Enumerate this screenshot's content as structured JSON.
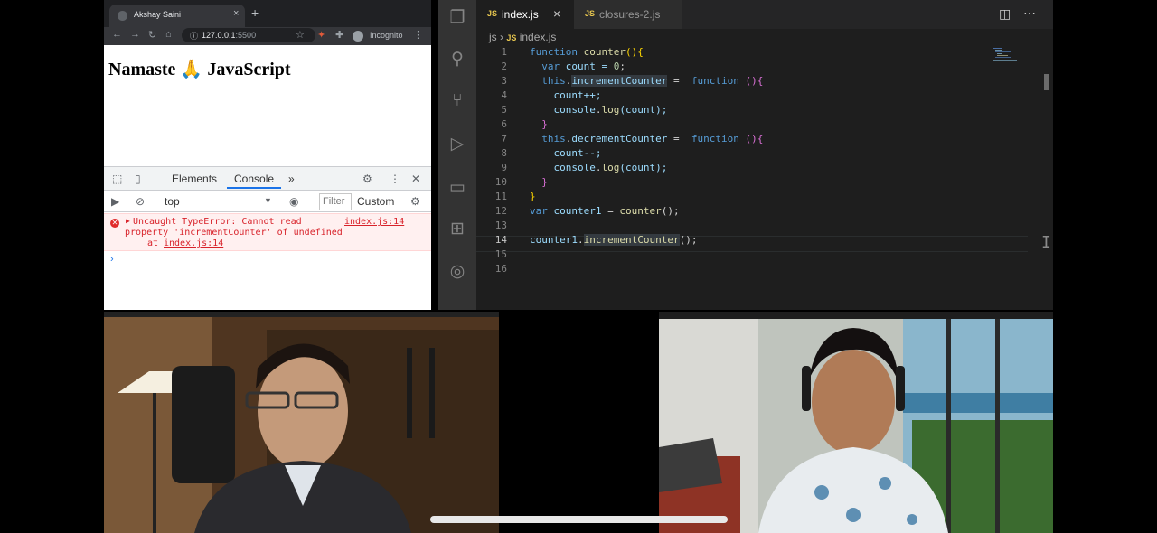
{
  "browser": {
    "tab_title": "Akshay Saini",
    "tab_close": "×",
    "new_tab": "+",
    "url_host": "127.0.0.1",
    "url_port": ":5500",
    "incognito_label": "Incognito",
    "page_heading": "Namaste 🙏 JavaScript"
  },
  "devtools": {
    "tabs": [
      "Elements",
      "Console"
    ],
    "more_tabs": "»",
    "active_tab": "Console",
    "context": "top",
    "filter_placeholder": "Filter",
    "levels": "Custom",
    "error": {
      "line1": "Uncaught TypeError: Cannot read",
      "line2": "property 'incrementCounter' of undefined",
      "at_prefix": "at ",
      "at_link": "index.js:14",
      "source_link": "index.js:14"
    },
    "prompt": "›"
  },
  "vscode": {
    "tabs": [
      {
        "badge": "JS",
        "label": "index.js",
        "close": "×"
      },
      {
        "badge": "JS",
        "label": "closures-2.js"
      }
    ],
    "breadcrumb": {
      "folder": "js",
      "badge": "JS",
      "file": "index.js"
    },
    "line_numbers": [
      "1",
      "2",
      "3",
      "4",
      "5",
      "6",
      "7",
      "8",
      "9",
      "10",
      "11",
      "12",
      "13",
      "14",
      "15",
      "16"
    ],
    "code": {
      "l1": [
        "function",
        " ",
        "counter",
        "()",
        "{"
      ],
      "l2": [
        "  ",
        "var",
        " count = ",
        "0",
        ";"
      ],
      "l3": [
        "  ",
        "this",
        ".",
        "incrementCounter",
        " =  ",
        "function",
        " ",
        "()",
        "{"
      ],
      "l4": [
        "    ",
        "count++;"
      ],
      "l5": [
        "    ",
        "console",
        ".",
        "log",
        "(count);"
      ],
      "l6": [
        "  ",
        "}"
      ],
      "l7": [
        "  ",
        "this",
        ".",
        "decrementCounter",
        " =  ",
        "function",
        " ",
        "()",
        "{"
      ],
      "l8": [
        "    ",
        "count--;"
      ],
      "l9": [
        "    ",
        "console",
        ".",
        "log",
        "(count);"
      ],
      "l10": [
        "  ",
        "}"
      ],
      "l11": [
        "}"
      ],
      "l12": [
        "var",
        " ",
        "counter1",
        " = ",
        "counter",
        "();"
      ],
      "l14": [
        "counter1",
        ".",
        "incrementCounter",
        "();"
      ]
    }
  },
  "colors": {
    "editor_bg": "#1e1e1e",
    "activity_bar": "#333333",
    "keyword": "#569cd6",
    "function_name": "#dcdcaa",
    "property": "#9cdcfe",
    "number": "#b5cea8",
    "error_text": "#d8222a",
    "devtools_accent": "#1a73e8"
  }
}
